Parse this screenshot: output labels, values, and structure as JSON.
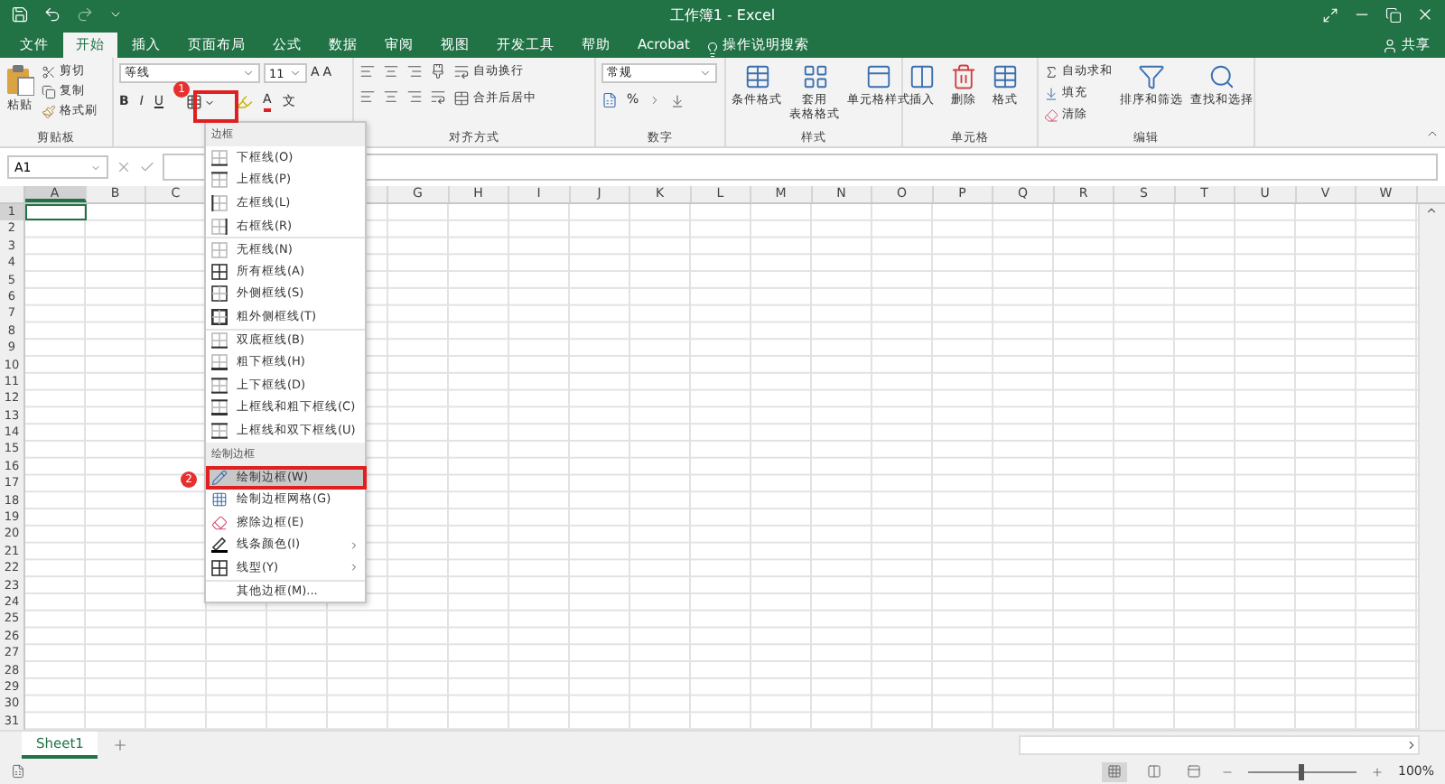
{
  "title_bar": {
    "title": "工作簿1 - Excel"
  },
  "tabs": [
    {
      "label": "文件",
      "selected": false
    },
    {
      "label": "开始",
      "selected": true
    },
    {
      "label": "插入",
      "selected": false
    },
    {
      "label": "页面布局",
      "selected": false
    },
    {
      "label": "公式",
      "selected": false
    },
    {
      "label": "数据",
      "selected": false
    },
    {
      "label": "审阅",
      "selected": false
    },
    {
      "label": "视图",
      "selected": false
    },
    {
      "label": "开发工具",
      "selected": false
    },
    {
      "label": "帮助",
      "selected": false
    },
    {
      "label": "Acrobat",
      "selected": false
    }
  ],
  "tell_me": "操作说明搜索",
  "share": "共享",
  "ribbon": {
    "clipboard": {
      "paste": "粘贴",
      "cut": "剪切",
      "copy": "复制",
      "format_painter": "格式刷",
      "label": "剪贴板"
    },
    "font": {
      "name": "等线",
      "size": "11",
      "grow": "A",
      "shrink": "A",
      "bold": "B",
      "italic": "I",
      "underline": "U",
      "font_color": "A",
      "phonetic": "文"
    },
    "alignment": {
      "wrap": "自动换行",
      "merge": "合并后居中",
      "label": "对齐方式"
    },
    "number": {
      "format": "常规",
      "percent": "%",
      "label": "数字"
    },
    "styles": {
      "conditional": "条件格式",
      "table_line1": "套用",
      "table_line2": "表格格式",
      "cell_styles": "单元格样式",
      "label": "样式"
    },
    "cells": {
      "insert": "插入",
      "delete": "删除",
      "format": "格式",
      "label": "单元格"
    },
    "editing": {
      "autosum": "自动求和",
      "fill": "填充",
      "clear": "清除",
      "sort": "排序和筛选",
      "find": "查找和选择",
      "label": "编辑"
    }
  },
  "name_box": "A1",
  "columns": [
    {
      "label": "A",
      "selected": true
    },
    {
      "label": "B",
      "selected": false
    },
    {
      "label": "C",
      "selected": false
    },
    {},
    {},
    {},
    {
      "label": "G",
      "selected": false
    },
    {
      "label": "H",
      "selected": false
    },
    {
      "label": "I",
      "selected": false
    },
    {
      "label": "J",
      "selected": false
    },
    {
      "label": "K",
      "selected": false
    },
    {
      "label": "L",
      "selected": false
    },
    {
      "label": "M",
      "selected": false
    },
    {
      "label": "N",
      "selected": false
    },
    {
      "label": "O",
      "selected": false
    },
    {
      "label": "P",
      "selected": false
    },
    {
      "label": "Q",
      "selected": false
    },
    {
      "label": "R",
      "selected": false
    },
    {
      "label": "S",
      "selected": false
    },
    {
      "label": "T",
      "selected": false
    },
    {
      "label": "U",
      "selected": false
    },
    {
      "label": "V",
      "selected": false
    },
    {
      "label": "W",
      "selected": false
    }
  ],
  "rows": [
    {
      "label": "1",
      "selected": true
    },
    {
      "label": "2",
      "selected": false
    },
    {
      "label": "3",
      "selected": false
    },
    {
      "label": "4",
      "selected": false
    },
    {
      "label": "5",
      "selected": false
    },
    {
      "label": "6",
      "selected": false
    },
    {
      "label": "7",
      "selected": false
    },
    {
      "label": "8",
      "selected": false
    },
    {
      "label": "9",
      "selected": false
    },
    {
      "label": "10",
      "selected": false
    },
    {
      "label": "11",
      "selected": false
    },
    {
      "label": "12",
      "selected": false
    },
    {
      "label": "13",
      "selected": false
    },
    {
      "label": "14",
      "selected": false
    },
    {
      "label": "15",
      "selected": false
    },
    {
      "label": "16",
      "selected": false
    },
    {
      "label": "17",
      "selected": false
    },
    {
      "label": "18",
      "selected": false
    },
    {
      "label": "19",
      "selected": false
    },
    {
      "label": "20",
      "selected": false
    },
    {
      "label": "21",
      "selected": false
    },
    {
      "label": "22",
      "selected": false
    },
    {
      "label": "23",
      "selected": false
    },
    {
      "label": "24",
      "selected": false
    },
    {
      "label": "25",
      "selected": false
    },
    {
      "label": "26",
      "selected": false
    },
    {
      "label": "27",
      "selected": false
    },
    {
      "label": "28",
      "selected": false
    },
    {
      "label": "29",
      "selected": false
    },
    {
      "label": "30",
      "selected": false
    },
    {
      "label": "31",
      "selected": false
    }
  ],
  "border_menu": {
    "sections": [
      {
        "header": "边框",
        "items": [
          {
            "label": "下框线(O)",
            "selected": false,
            "submenu": false
          },
          {
            "label": "上框线(P)",
            "selected": false,
            "submenu": false
          },
          {
            "label": "左框线(L)",
            "selected": false,
            "submenu": false
          },
          {
            "label": "右框线(R)",
            "selected": false,
            "submenu": false
          }
        ]
      },
      {
        "items": [
          {
            "label": "无框线(N)",
            "selected": false,
            "submenu": false
          },
          {
            "label": "所有框线(A)",
            "selected": false,
            "submenu": false
          },
          {
            "label": "外侧框线(S)",
            "selected": false,
            "submenu": false
          },
          {
            "label": "粗外侧框线(T)",
            "selected": false,
            "submenu": false
          }
        ]
      },
      {
        "items": [
          {
            "label": "双底框线(B)",
            "selected": false,
            "submenu": false
          },
          {
            "label": "粗下框线(H)",
            "selected": false,
            "submenu": false
          },
          {
            "label": "上下框线(D)",
            "selected": false,
            "submenu": false
          },
          {
            "label": "上框线和粗下框线(C)",
            "selected": false,
            "submenu": false
          },
          {
            "label": "上框线和双下框线(U)",
            "selected": false,
            "submenu": false
          }
        ]
      },
      {
        "header": "绘制边框",
        "items": [
          {
            "label": "绘制边框(W)",
            "selected": true,
            "submenu": false
          },
          {
            "label": "绘制边框网格(G)",
            "selected": false,
            "submenu": false
          },
          {
            "label": "擦除边框(E)",
            "selected": false,
            "submenu": false
          },
          {
            "label": "线条颜色(I)",
            "selected": false,
            "submenu": true
          },
          {
            "label": "线型(Y)",
            "selected": false,
            "submenu": true
          }
        ]
      },
      {
        "items": [
          {
            "label": "其他边框(M)...",
            "selected": false,
            "submenu": false
          }
        ]
      }
    ]
  },
  "annotations": [
    {
      "label": "1"
    },
    {
      "label": "2"
    }
  ],
  "sheet_tabs": [
    {
      "label": "Sheet1",
      "selected": true
    }
  ],
  "status_bar": {
    "views": [
      {
        "kind": "normal",
        "selected": true
      },
      {
        "kind": "page_layout",
        "selected": false
      },
      {
        "kind": "page_break",
        "selected": false
      }
    ],
    "zoom": {
      "level": 0.5
    },
    "zoom_label": "100%"
  }
}
